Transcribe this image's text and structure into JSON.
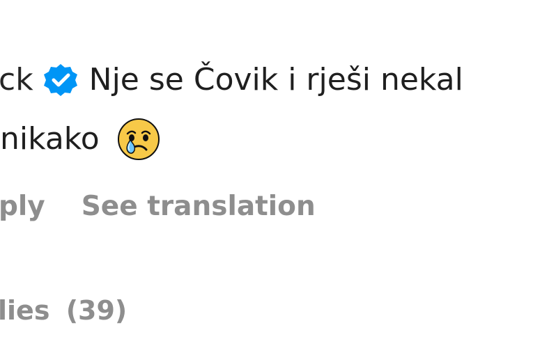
{
  "comment": {
    "username": "ck",
    "text_line_1": "Nje se Čovik i rješi nekal",
    "text_line_2": "nikako",
    "verified_icon": "verified-badge-icon",
    "emoji_icon": "crying-face-emoji-icon"
  },
  "actions": {
    "reply_label": "ply",
    "translation_label": "See translation"
  },
  "replies": {
    "label": "lies",
    "count": "(39)"
  },
  "colors": {
    "text": "#1f1f1f",
    "muted": "#8e8e8e",
    "verified": "#0095f6",
    "emoji_face": "#f7c948",
    "emoji_tear": "#6ec6ff"
  }
}
